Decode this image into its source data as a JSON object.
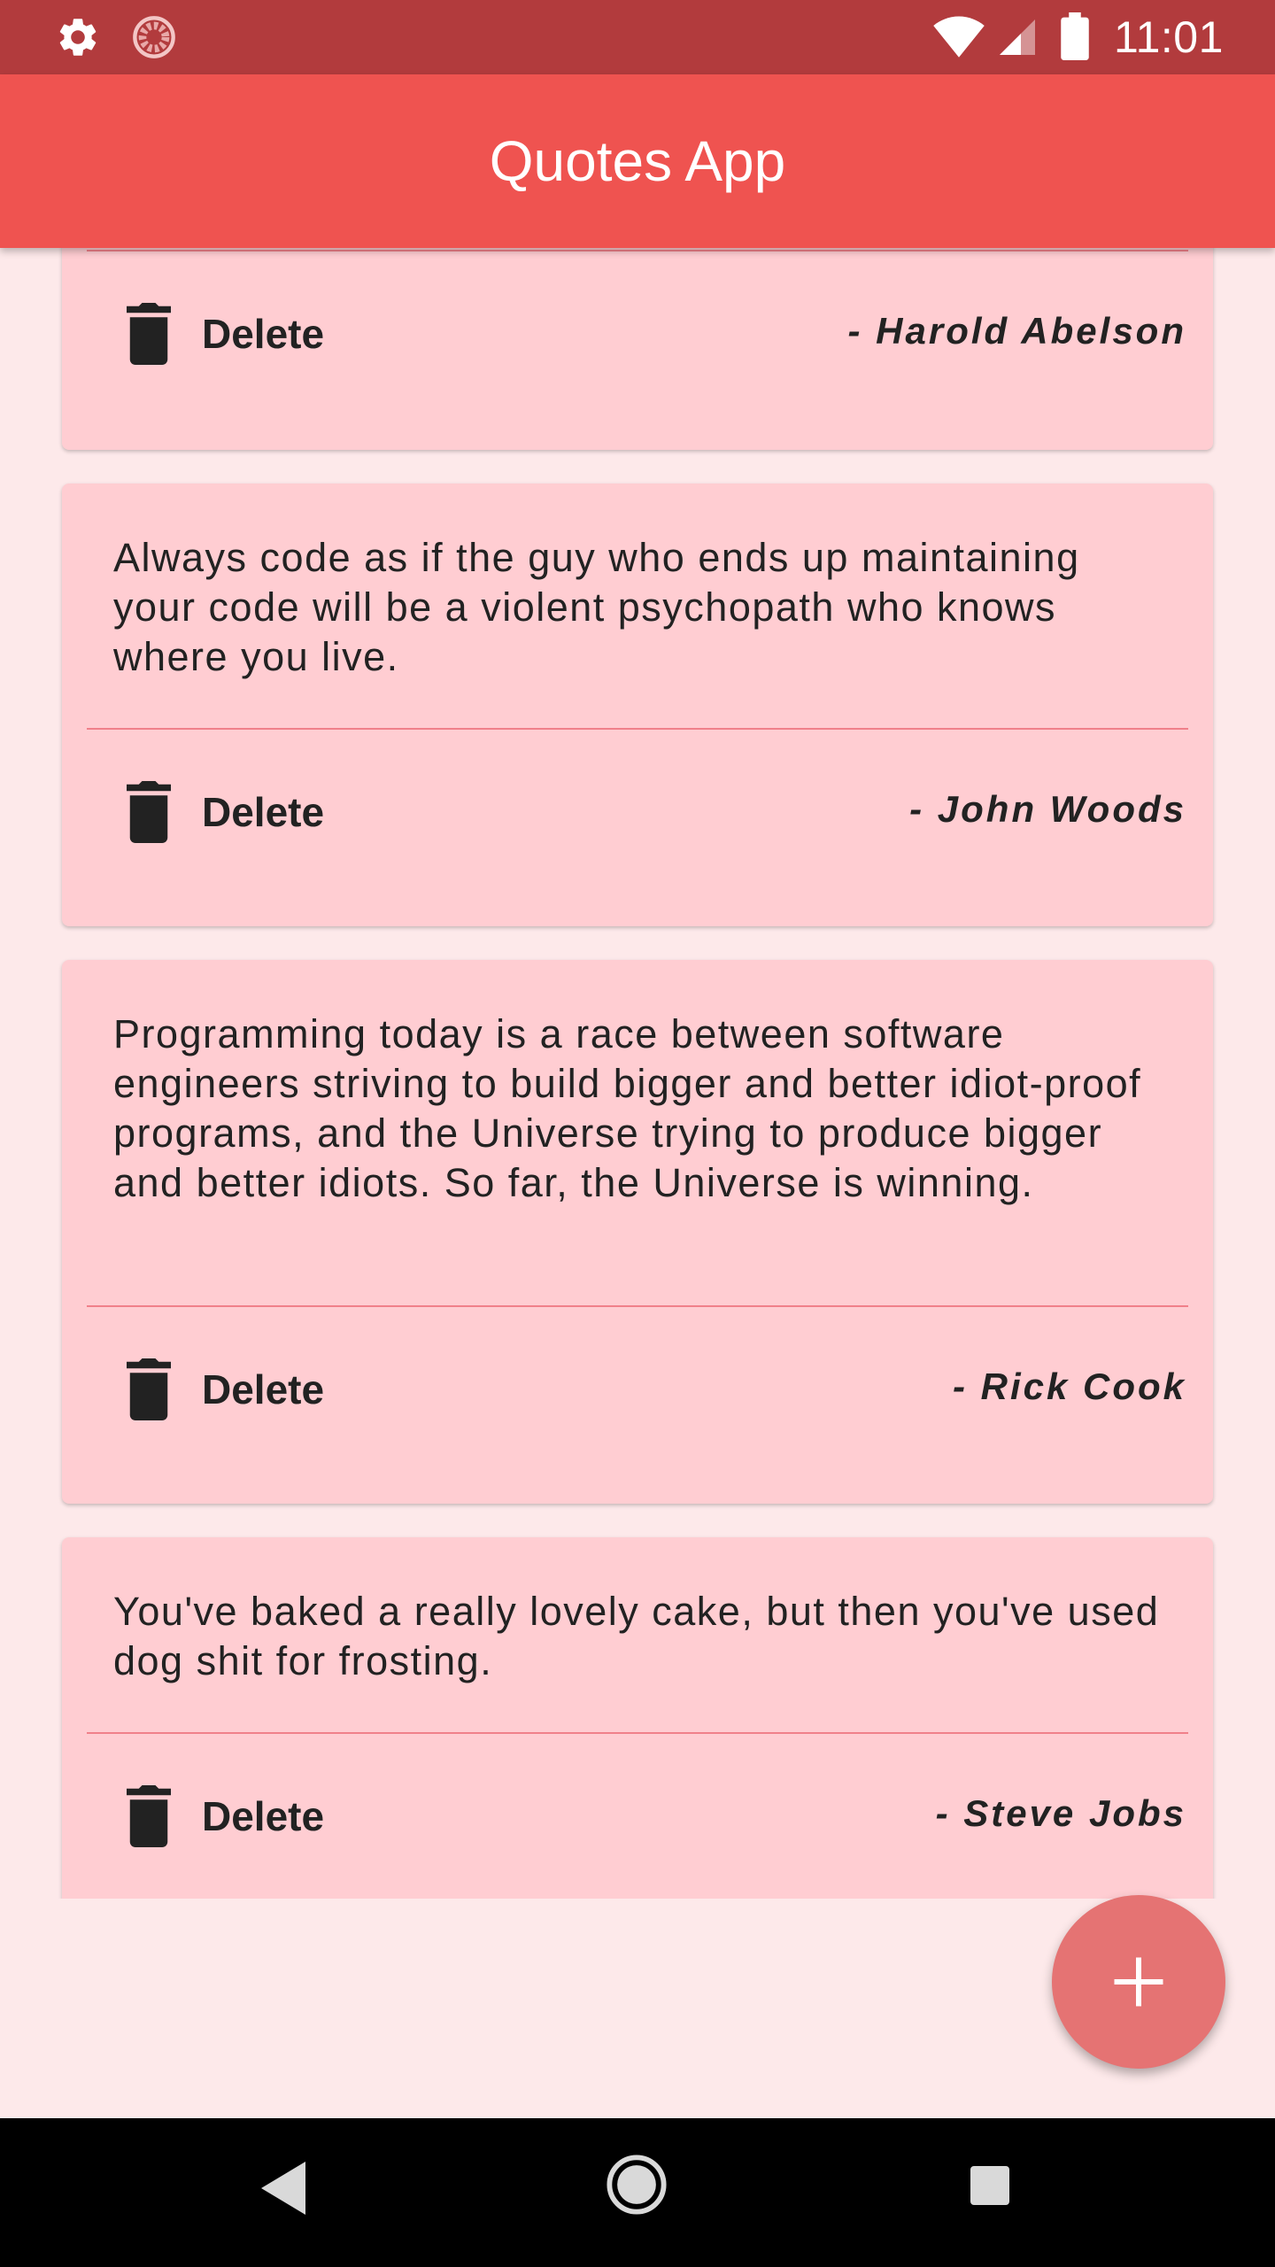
{
  "status_bar": {
    "time": "11:01",
    "icons": [
      "gear-icon",
      "loader-icon",
      "wifi-icon",
      "signal-icon",
      "battery-icon"
    ]
  },
  "app_bar": {
    "title": "Quotes App"
  },
  "cards": [
    {
      "quote": "",
      "delete_label": "Delete",
      "author": "- Harold Abelson"
    },
    {
      "quote": "Always code as if the guy who ends up maintaining your code will be a violent psychopath who knows where you live.",
      "delete_label": "Delete",
      "author": "- John Woods"
    },
    {
      "quote": "Programming today is a race between software engineers striving to build bigger and better idiot-proof programs, and the Universe trying to produce bigger and better idiots. So far, the Universe is winning.",
      "delete_label": "Delete",
      "author": "- Rick Cook"
    },
    {
      "quote": "You've baked a really lovely cake, but then you've used dog shit for frosting.",
      "delete_label": "Delete",
      "author": "- Steve Jobs"
    }
  ],
  "fab": {
    "icon": "plus-icon"
  },
  "nav_bar": {
    "icons": [
      "back-icon",
      "home-icon",
      "recents-icon"
    ]
  },
  "colors": {
    "status_bar": "#b23b3d",
    "app_bar": "#ef5350",
    "background": "#fde9ea",
    "card": "#ffcdd2",
    "fab": "#e57373"
  }
}
